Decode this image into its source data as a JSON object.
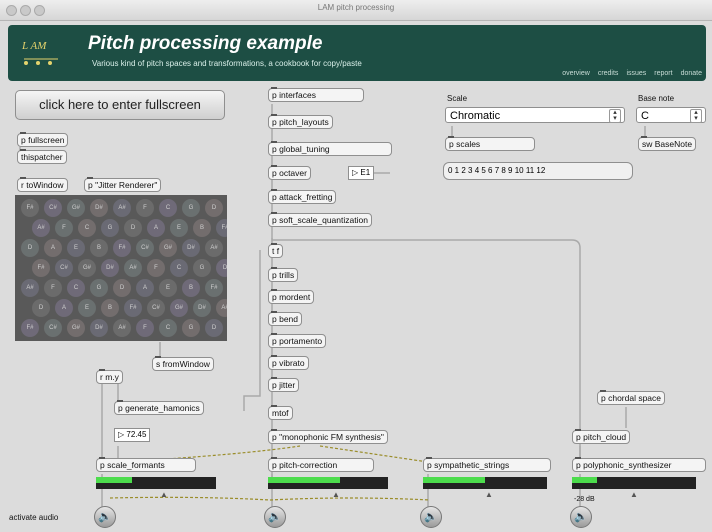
{
  "window": {
    "title": "LAM pitch processing"
  },
  "header": {
    "logo_text": "L AM",
    "title": "Pitch processing example",
    "subtitle": "Various kind of pitch spaces and transformations, a cookbook for copy/paste",
    "nav": [
      "overview",
      "credits",
      "issues",
      "report",
      "donate"
    ]
  },
  "left": {
    "fullscreen_button": "click here to enter fullscreen",
    "p_fullscreen": "p fullscreen",
    "thispatcher": "thispatcher",
    "r_towindow": "r toWindow",
    "p_jitter": "p \"Jitter Renderer\"",
    "s_fromwindow": "s fromWindow",
    "rmy": "r m.y",
    "generate": "p generate_hamonics",
    "number": "72.45",
    "activate_audio": "activate audio"
  },
  "grid_notes": [
    "F#",
    "C#",
    "G#",
    "D#",
    "A#",
    "F",
    "C",
    "G",
    "D",
    "A",
    "E",
    "B"
  ],
  "chain": [
    "p interfaces",
    "p pitch_layouts",
    "p global_tuning",
    "p octaver",
    "p attack_fretting",
    "p soft_scale_quantization",
    "t f",
    "p trills",
    "p mordent",
    "p bend",
    "p portamento",
    "p vibrato",
    "p jitter",
    "mtof",
    "p \"monophonic FM synthesis\""
  ],
  "octaver_value": "E1",
  "scale": {
    "label": "Scale",
    "selected": "Chromatic",
    "basenote_label": "Base note",
    "basenote_selected": "C",
    "p_scales": "p scales",
    "sw_basenote": "sw BaseNote",
    "list": "0 1 2 3 4 5 6 7 8 9 10 11 12"
  },
  "right": {
    "chordal": "p chordal space",
    "cloud": "p pitch_cloud",
    "polyphonic": "p polyphonic_synthesizer",
    "db": "-28 dB"
  },
  "bottom": {
    "scale_formants": "p scale_formants",
    "pitch_correction": "p pitch-correction",
    "sympathetic": "p sympathetic_strings",
    "meter_levels": [
      0.3,
      0.6,
      0.5,
      0.2
    ]
  },
  "colors": {
    "header_bg": "#1d4e44",
    "meter_green": "#4cdc4c"
  }
}
